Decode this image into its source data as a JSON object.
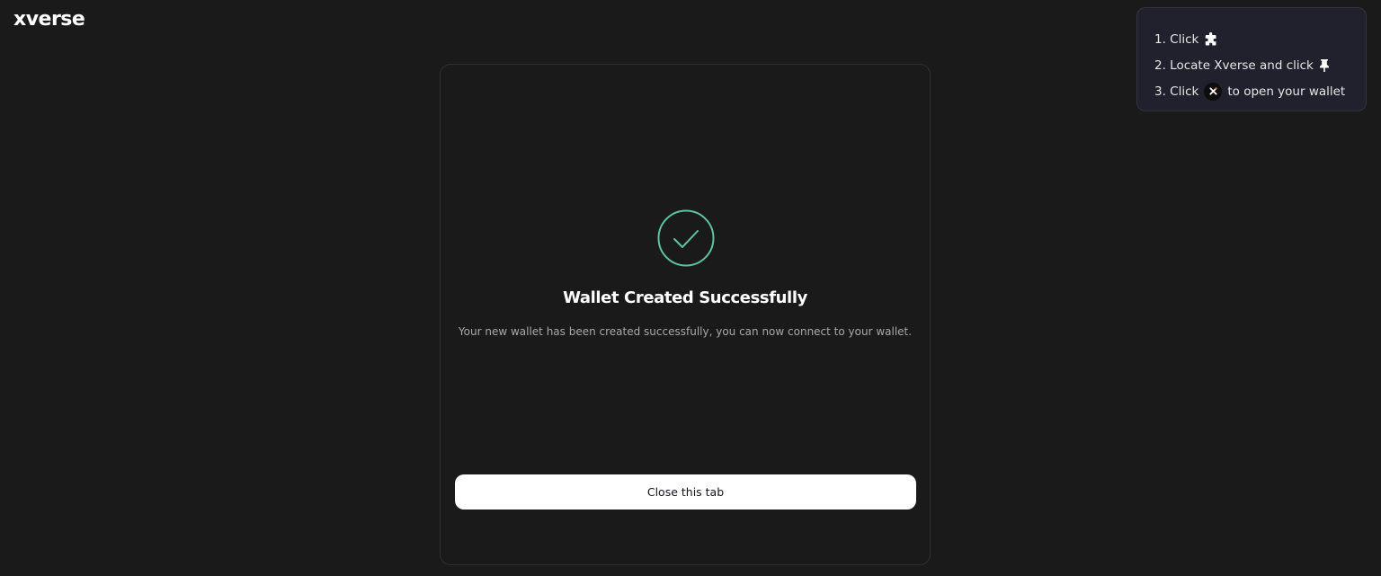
{
  "brand": {
    "logo_text": "xverse"
  },
  "pin_hint": {
    "step1_text": "1. Click",
    "step1_icon": "puzzle-piece-icon",
    "step2_text": "2. Locate Xverse and click",
    "step2_icon": "pin-icon",
    "step3_text_before": "3. Click",
    "step3_icon": "xverse-x-icon",
    "step3_text_after": "to open your wallet"
  },
  "success_card": {
    "icon": "check-circle-icon",
    "title": "Wallet Created Successfully",
    "description": "Your new wallet has been created successfully, you can now connect to your wallet.",
    "close_button_label": "Close this tab"
  },
  "colors": {
    "background": "#1a1a1a",
    "accent_green": "#5ec4a0",
    "hint_background": "#21212d",
    "button_background": "#ffffff"
  }
}
